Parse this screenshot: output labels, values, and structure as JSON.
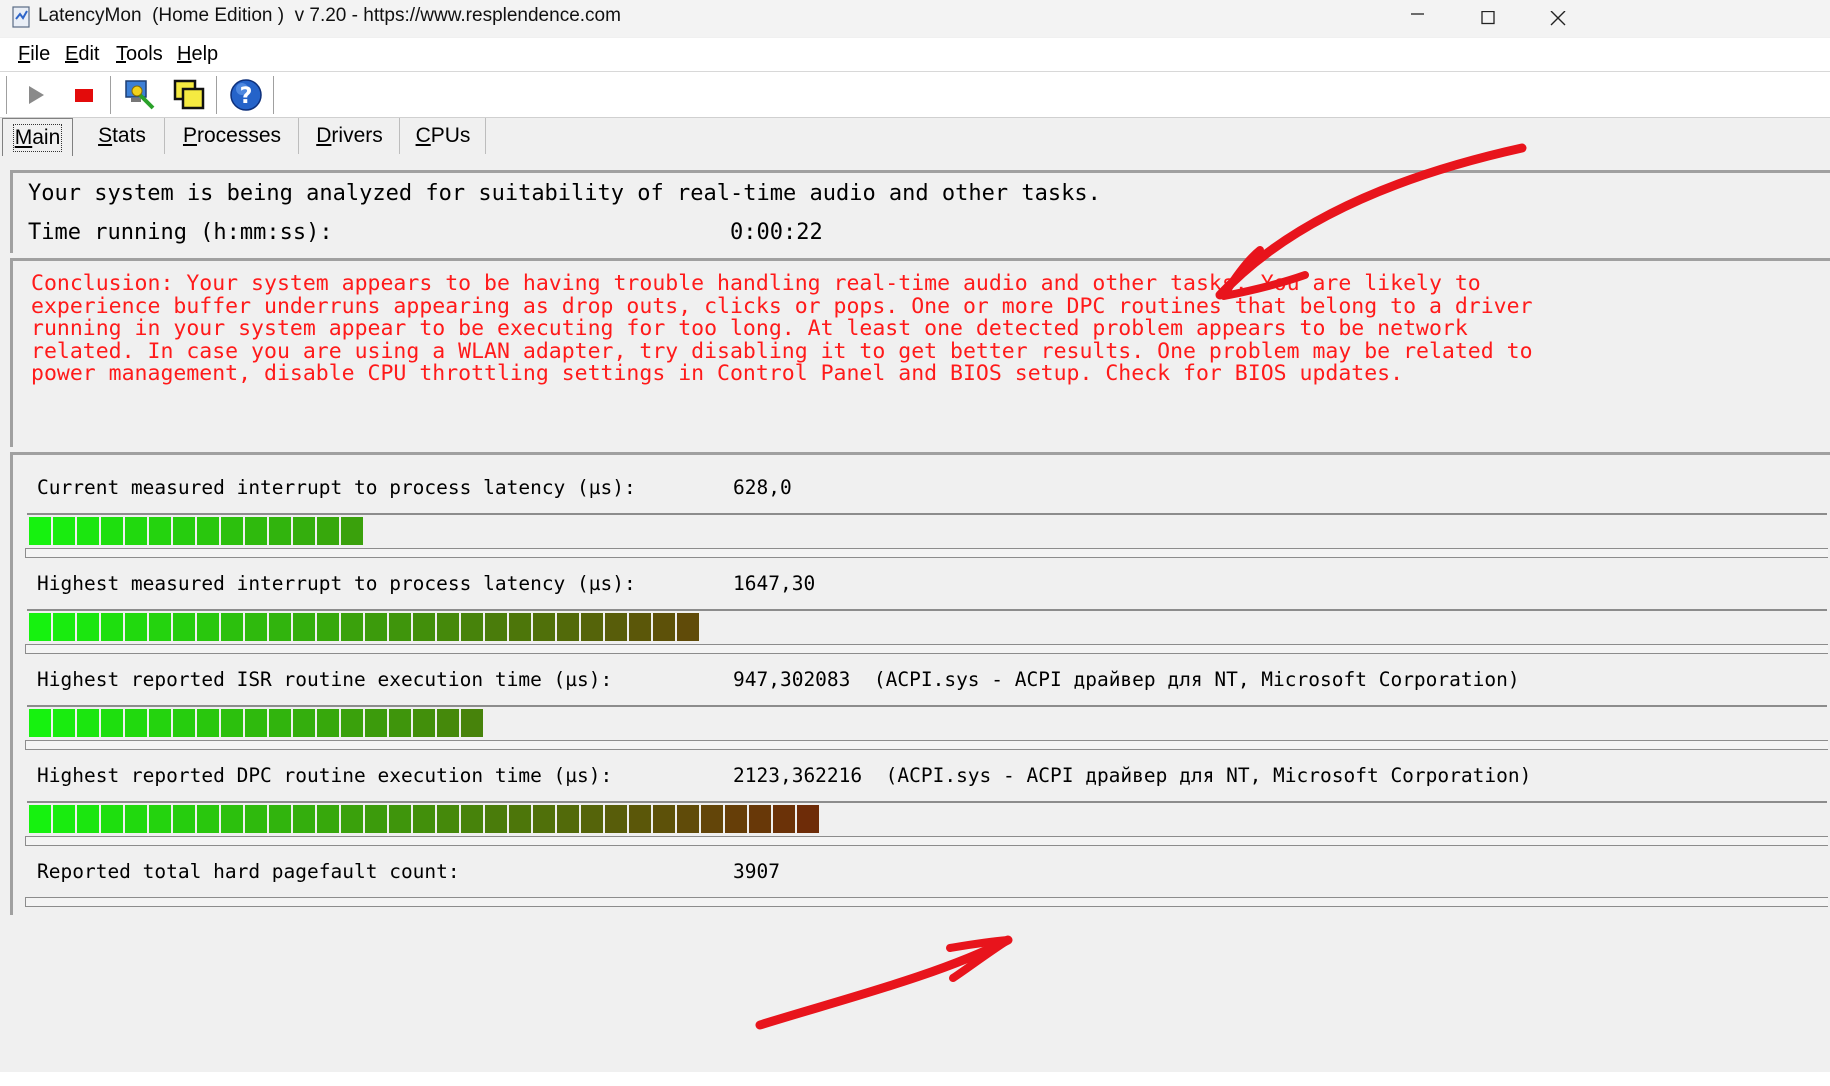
{
  "window": {
    "title": "LatencyMon  (Home Edition )  v 7.20 - https://www.resplendence.com",
    "icon": "latencymon-app-icon",
    "controls": [
      "minimize",
      "maximize",
      "close"
    ]
  },
  "menu": [
    "File",
    "Edit",
    "Tools",
    "Help"
  ],
  "toolbar": {
    "buttons": [
      "play-icon",
      "stop-icon",
      "monitor-icon",
      "windows-icon",
      "help-icon"
    ]
  },
  "tabs": [
    "Main",
    "Stats",
    "Processes",
    "Drivers",
    "CPUs"
  ],
  "status": {
    "analyzing": "Your system is being analyzed for suitability of real-time audio and other tasks.",
    "time_label": "Time running (h:mm:ss):",
    "time_value": "0:00:22"
  },
  "conclusion": "Conclusion: Your system appears to be having trouble handling real-time audio and other tasks. You are likely to experience buffer underruns appearing as drop outs, clicks or pops. One or more DPC routines that belong to a driver running in your system appear to be executing for too long. At least one detected problem appears to be network related. In case you are using a WLAN adapter, try disabling it to get better results. One problem may be related to power management, disable CPU throttling settings in Control Panel and BIOS setup. Check for BIOS updates.",
  "metrics": [
    {
      "label": "Current measured interrupt to process latency (µs):",
      "value": "628,0",
      "note": "",
      "level": 0.185
    },
    {
      "label": "Highest measured interrupt to process latency (µs):",
      "value": "1647,30",
      "note": "",
      "level": 0.385
    },
    {
      "label": "Highest reported ISR routine execution time (µs):",
      "value": "947,302083",
      "note": "(ACPI.sys - ACPI драйвер для NT, Microsoft Corporation)",
      "level": 0.26
    },
    {
      "label": "Highest reported DPC routine execution time (µs):",
      "value": "2123,362216",
      "note": "(ACPI.sys - ACPI драйвер для NT, Microsoft Corporation)",
      "level": 0.447
    },
    {
      "label": "Reported total hard pagefault count:",
      "value": "3907",
      "note": "",
      "level": 0
    }
  ],
  "colors": {
    "conclusion_text": "#ff1a1a",
    "annotation": "#e8141c",
    "bar_start": "#16f20f",
    "bar_end": "#6b3208"
  }
}
